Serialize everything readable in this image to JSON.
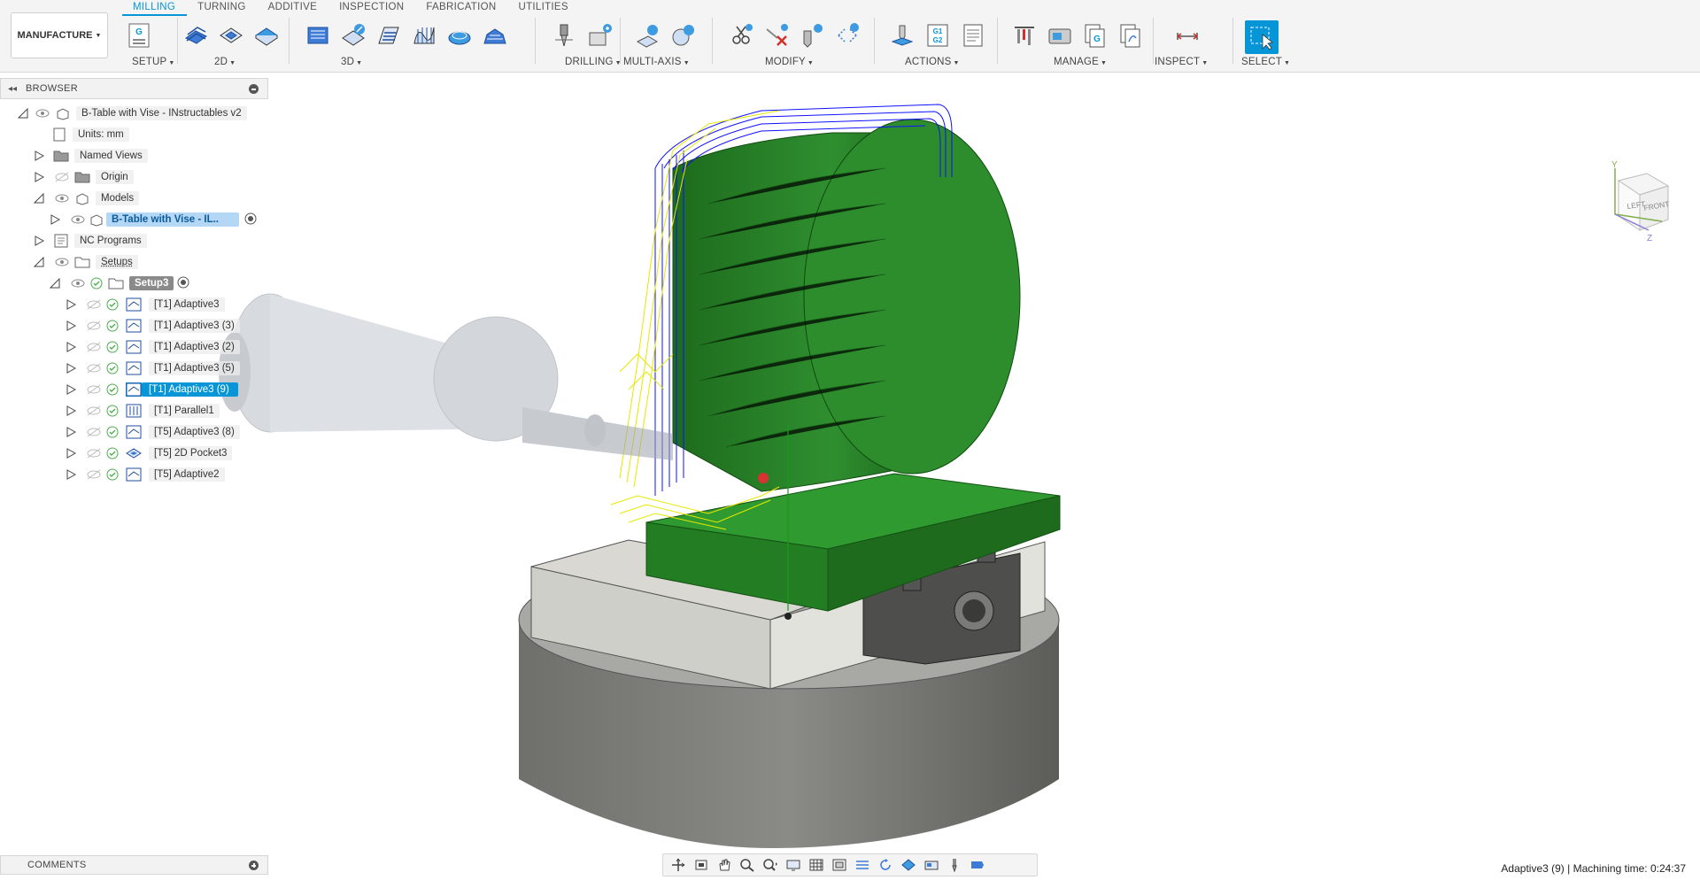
{
  "workspace": {
    "label": "MANUFACTURE"
  },
  "tabs": [
    {
      "label": "MILLING",
      "active": true
    },
    {
      "label": "TURNING"
    },
    {
      "label": "ADDITIVE"
    },
    {
      "label": "INSPECTION"
    },
    {
      "label": "FABRICATION"
    },
    {
      "label": "UTILITIES"
    }
  ],
  "groups": {
    "setup": "SETUP",
    "two_d": "2D",
    "three_d": "3D",
    "drilling": "DRILLING",
    "multi_axis": "MULTI-AXIS",
    "modify": "MODIFY",
    "actions": "ACTIONS",
    "manage": "MANAGE",
    "inspect": "INSPECT",
    "select": "SELECT"
  },
  "icons": {
    "setup_g": "G",
    "actions_g1": "G1",
    "actions_g2": "G2",
    "manage_g": "G"
  },
  "browser": {
    "title": "BROWSER",
    "root": "B-Table with Vise - INstructables v2",
    "units": "Units: mm",
    "named_views": "Named Views",
    "origin": "Origin",
    "models": "Models",
    "model_item": "B-Table with Vise - IL..",
    "nc_programs": "NC Programs",
    "setups": "Setups",
    "setup3": "Setup3",
    "operations": [
      {
        "label": "[T1] Adaptive3",
        "icon": "adaptive-icon"
      },
      {
        "label": "[T1] Adaptive3 (3)",
        "icon": "adaptive-icon"
      },
      {
        "label": "[T1] Adaptive3 (2)",
        "icon": "adaptive-icon"
      },
      {
        "label": "[T1] Adaptive3 (5)",
        "icon": "adaptive-icon"
      },
      {
        "label": "[T1] Adaptive3 (9)",
        "icon": "adaptive-icon",
        "selected": true
      },
      {
        "label": "[T1] Parallel1",
        "icon": "parallel-icon"
      },
      {
        "label": "[T5] Adaptive3 (8)",
        "icon": "adaptive-icon"
      },
      {
        "label": "[T5] 2D Pocket3",
        "icon": "pocket-icon"
      },
      {
        "label": "[T5] Adaptive2",
        "icon": "adaptive-icon"
      }
    ]
  },
  "viewcube": {
    "left": "LEFT",
    "front": "FRONT",
    "axis_y": "Y",
    "axis_z": "Z"
  },
  "comments": {
    "title": "COMMENTS"
  },
  "status": {
    "text": "Adaptive3 (9) | Machining time: 0:24:37"
  },
  "colors": {
    "accent": "#0696d7",
    "model_green": "#2e8b2e",
    "toolpath_blue": "#1a1aff",
    "toolpath_yellow": "#e6e600"
  }
}
